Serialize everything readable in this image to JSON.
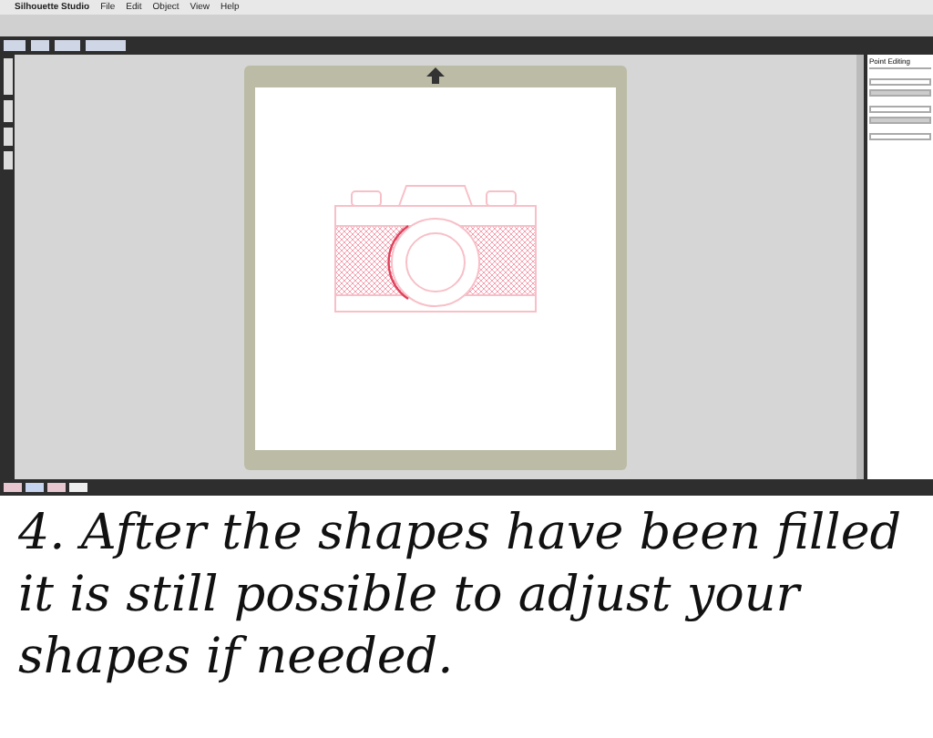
{
  "menu_bar": {
    "items": [
      {
        "label": "Silhouette Studio"
      },
      {
        "label": "File"
      },
      {
        "label": "Edit"
      },
      {
        "label": "Object"
      },
      {
        "label": "View"
      },
      {
        "label": "Help"
      }
    ]
  },
  "panel": {
    "title": "Point Editing"
  },
  "caption": "4. After the shapes have been filled it is still possible to adjust your shapes if needed."
}
